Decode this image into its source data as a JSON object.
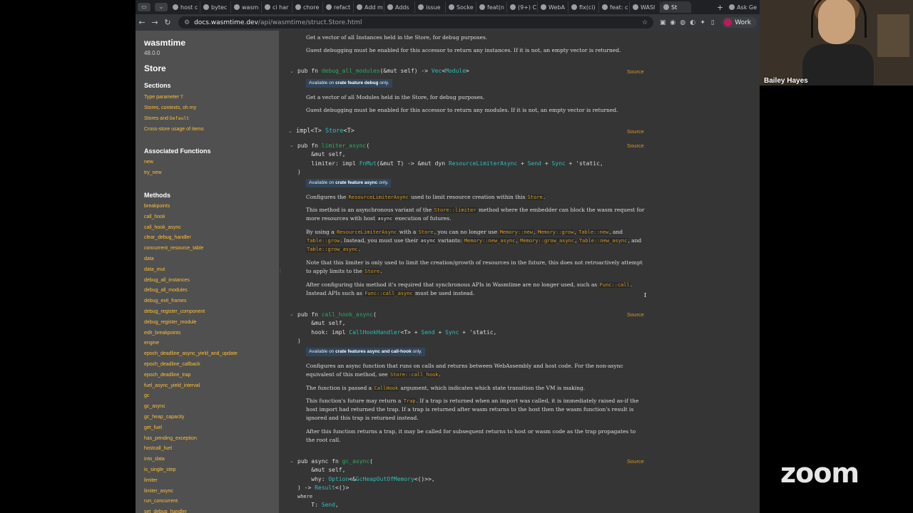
{
  "tabs": [
    "host c",
    "bytec",
    "wasm",
    "ci har",
    "chore",
    "refact",
    "Add m",
    "Adds",
    "issue",
    "Socke",
    "feat(n",
    "(9+) C",
    "WebA",
    "fix(ci)",
    "feat: c",
    "WASI",
    "St"
  ],
  "ask_label": "Ask Ge",
  "url": {
    "host": "docs.wasmtime.dev",
    "path": "/api/wasmtime/struct.Store.html"
  },
  "profile_label": "Work",
  "sidebar": {
    "crate": "wasmtime",
    "version": "48.0.0",
    "struct_name": "Store",
    "sections_heading": "Sections",
    "sections": [
      {
        "text": "Type parameter ",
        "code": "T"
      },
      {
        "text": "Stores, contexts, oh my",
        "code": ""
      },
      {
        "text": "Stores and ",
        "code": "Default"
      },
      {
        "text": "Cross-store usage of items",
        "code": ""
      }
    ],
    "assoc_heading": "Associated Functions",
    "assoc": [
      "new",
      "try_new"
    ],
    "methods_heading": "Methods",
    "methods": [
      "breakpoints",
      "call_hook",
      "call_hook_async",
      "clear_debug_handler",
      "concurrent_resource_table",
      "data",
      "data_mut",
      "debug_all_instances",
      "debug_all_modules",
      "debug_exit_frames",
      "debug_register_component",
      "debug_register_module",
      "edit_breakpoints",
      "engine",
      "epoch_deadline_async_yield_and_update",
      "epoch_deadline_callback",
      "epoch_deadline_trap",
      "fuel_async_yield_interval",
      "gc",
      "gc_async",
      "gc_heap_capacity",
      "get_fuel",
      "has_pending_exception",
      "hostcall_fuel",
      "into_data",
      "is_single_step",
      "limiter",
      "limiter_async",
      "run_concurrent",
      "set_debug_handler"
    ]
  },
  "content": {
    "instances_desc": "Get a vector of all Instances held in the Store, for debug purposes.",
    "instances_note": "Guest debugging must be enabled for this accessor to return any instances. If it is not, an empty vector is returned.",
    "source_label": "Source",
    "modules_sig": {
      "pub": "pub fn ",
      "name": "debug_all_modules",
      "args": "(&mut self) -> ",
      "ret": "Vec",
      "lt": "<",
      "ret2": "Module",
      "gt": ">"
    },
    "modules_stab": {
      "pre": "Available on ",
      "feat": "crate feature debug",
      "post": " only."
    },
    "modules_desc": "Get a vector of all Modules held in the Store, for debug purposes.",
    "modules_note": "Guest debugging must be enabled for this accessor to return any modules. If it is not, an empty vector is returned.",
    "impl_line": {
      "a": "impl<T> ",
      "b": "Store",
      "c": "<T>"
    },
    "limiter_sig": {
      "l1a": "pub fn ",
      "l1b": "limiter_async",
      "l1c": "(",
      "l2": "    &mut self,",
      "l3a": "    limiter: impl ",
      "l3b": "FnMut",
      "l3c": "(&mut T) -> &mut dyn ",
      "l3d": "ResourceLimiterAsync",
      "l3e": " + ",
      "l3f": "Send",
      "l3g": " + ",
      "l3h": "Sync",
      "l3i": " + 'static,",
      "l4": ")"
    },
    "limiter_stab": {
      "pre": "Available on ",
      "feat": "crate feature async",
      "post": " only."
    },
    "limiter_p1": {
      "a": "Configures the ",
      "b": "ResourceLimiterAsync",
      "c": " used to limit resource creation within this ",
      "d": "Store",
      "e": "."
    },
    "limiter_p2": {
      "a": "This method is an asynchronous variant of the ",
      "b": "Store::limiter",
      "c": " method where the embedder can block the wasm request for more resources with host ",
      "d": "async",
      "e": " execution of futures."
    },
    "limiter_p3": {
      "a": "By using a ",
      "b": "ResourceLimiterAsync",
      "c": " with a ",
      "d": "Store",
      "e": ", you can no longer use ",
      "f": "Memory::new",
      "g": ", ",
      "h": "Memory::grow",
      "i": ", ",
      "j": "Table::new",
      "k": ", and ",
      "l": "Table::grow",
      "m": ". Instead, you must use their ",
      "n": "async",
      "o": " variants: ",
      "p": "Memory::new_async",
      "q": ", ",
      "r": "Memory::grow_async",
      "s": ", ",
      "t": "Table::new_async",
      "u": ", and ",
      "v": "Table::grow_async",
      "w": "."
    },
    "limiter_p4": {
      "a": "Note that this limiter is only used to limit the creation/growth of resources in the future, this does not retroactively attempt to apply limits to the ",
      "b": "Store",
      "c": "."
    },
    "limiter_p5": {
      "a": "After configuring this method it's required that synchronous APIs in Wasmtime are no longer used, such as ",
      "b": "Func::call",
      "c": ". Instead APIs such as ",
      "d": "Func::call_async",
      "e": " must be used instead."
    },
    "callhook_sig": {
      "l1a": "pub fn ",
      "l1b": "call_hook_async",
      "l1c": "(",
      "l2": "    &mut self,",
      "l3a": "    hook: impl ",
      "l3b": "CallHookHandler",
      "l3c": "<T> + ",
      "l3d": "Send",
      "l3e": " + ",
      "l3f": "Sync",
      "l3g": " + 'static,",
      "l4": ")"
    },
    "callhook_stab": {
      "pre": "Available on ",
      "feat": "crate features async and call-hook",
      "post": " only."
    },
    "callhook_p1": {
      "a": "Configures an async function that runs on calls and returns between WebAssembly and host code. For the non-async equivalent of this method, see ",
      "b": "Store::call_hook",
      "c": "."
    },
    "callhook_p2": {
      "a": "The function is passed a ",
      "b": "CallHook",
      "c": " argument, which indicates which state transition the VM is making."
    },
    "callhook_p3": {
      "a": "This function's future may return a ",
      "b": "Trap",
      "c": ". If a trap is returned when an import was called, it is immediately raised as-if the host import had returned the trap. If a trap is returned after wasm returns to the host then the wasm function's result is ignored and this trap is returned instead."
    },
    "callhook_p4": "After this function returns a trap, it may be called for subsequent returns to host or wasm code as the trap propagates to the root call.",
    "gc_sig": {
      "l1a": "pub async fn ",
      "l1b": "gc_async",
      "l1c": "(",
      "l2": "    &mut self,",
      "l3a": "    why: ",
      "l3b": "Option",
      "l3c": "<&",
      "l3d": "GcHeapOutOfMemory",
      "l3e": "<()>>,",
      "l4a": ") -> ",
      "l4b": "Result",
      "l4c": "<()>",
      "l5": "where",
      "l6a": "    T: ",
      "l6b": "Send",
      "l6c": ","
    }
  },
  "cam": {
    "name": "Bailey Hayes"
  },
  "zoom_logo": "zoom"
}
